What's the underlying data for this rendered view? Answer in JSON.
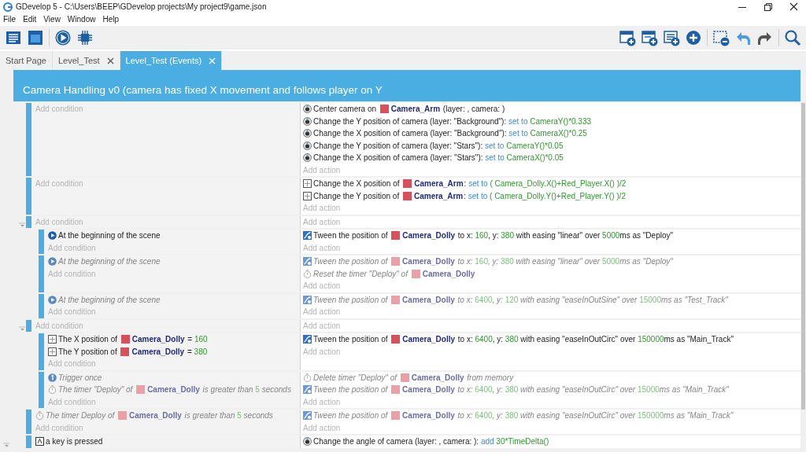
{
  "window": {
    "title": "GDevelop 5 - C:\\Users\\BEEP\\GDevelop projects\\My project9\\game.json"
  },
  "menu": [
    "File",
    "Edit",
    "View",
    "Window",
    "Help"
  ],
  "tabs": [
    {
      "label": "Start Page",
      "selected": false,
      "closable": false
    },
    {
      "label": "Level_Test",
      "selected": false,
      "closable": true
    },
    {
      "label": "Level_Test (Events)",
      "selected": true,
      "closable": true
    }
  ],
  "group": {
    "title": "Camera Handling v0 (camera has fixed X movement and follows player on Y",
    "expanded": true,
    "events": [
      {
        "add_condition": "Add condition",
        "add_action": "Add action",
        "actions": [
          {
            "kind": "camera",
            "disabled": false,
            "parts": [
              {
                "kind": "text",
                "text": "Center camera on "
              },
              {
                "kind": "object",
                "text": "Camera_Arm"
              },
              {
                "kind": "text",
                "text": " (layer: , camera: )"
              }
            ]
          },
          {
            "kind": "camera",
            "disabled": false,
            "parts": [
              {
                "kind": "text",
                "text": "Change the Y position of camera (layer: \"Background\"): "
              },
              {
                "kind": "operator",
                "text": "set to"
              },
              {
                "kind": "value",
                "text": " CameraY()*0.333"
              }
            ]
          },
          {
            "kind": "camera",
            "disabled": false,
            "parts": [
              {
                "kind": "text",
                "text": "Change the X position of camera (layer: \"Background\"): "
              },
              {
                "kind": "operator",
                "text": "set to"
              },
              {
                "kind": "value",
                "text": " CameraX()*0.25"
              }
            ]
          },
          {
            "kind": "camera",
            "disabled": false,
            "parts": [
              {
                "kind": "text",
                "text": "Change the Y position of camera (layer: \"Stars\"): "
              },
              {
                "kind": "operator",
                "text": "set to"
              },
              {
                "kind": "value",
                "text": " CameraY()*0.05"
              }
            ]
          },
          {
            "kind": "camera",
            "disabled": false,
            "parts": [
              {
                "kind": "text",
                "text": "Change the X position of camera (layer: \"Stars\"): "
              },
              {
                "kind": "operator",
                "text": "set to"
              },
              {
                "kind": "value",
                "text": " CameraX()*0.05"
              }
            ]
          }
        ]
      },
      {
        "add_condition": "Add condition",
        "add_action": "Add action",
        "actions": [
          {
            "kind": "position",
            "disabled": false,
            "parts": [
              {
                "kind": "text",
                "text": "Change the X position of "
              },
              {
                "kind": "object",
                "text": "Camera_Arm"
              },
              {
                "kind": "text",
                "text": ": "
              },
              {
                "kind": "operator",
                "text": "set to"
              },
              {
                "kind": "value",
                "text": " ( Camera_Dolly.X()+Red_Player.X() )/2"
              }
            ]
          },
          {
            "kind": "position",
            "disabled": false,
            "parts": [
              {
                "kind": "text",
                "text": "Change the Y position of "
              },
              {
                "kind": "object",
                "text": "Camera_Arm"
              },
              {
                "kind": "text",
                "text": ": "
              },
              {
                "kind": "operator",
                "text": "set to"
              },
              {
                "kind": "value",
                "text": " ( Camera_Dolly.Y()+Red_Player.Y() )/2"
              }
            ]
          }
        ]
      },
      {
        "add_condition": "Add condition",
        "add_action": "Add action",
        "expanded": true,
        "children": [
          {
            "add_condition": "Add condition",
            "add_action": "Add action",
            "conditions": [
              {
                "kind": "scene_start",
                "disabled": false,
                "parts": [
                  {
                    "kind": "text",
                    "text": "At the beginning of the scene"
                  }
                ]
              }
            ],
            "actions": [
              {
                "kind": "tween",
                "disabled": false,
                "parts": [
                  {
                    "kind": "text",
                    "text": "Tween the position of "
                  },
                  {
                    "kind": "object",
                    "text": "Camera_Dolly"
                  },
                  {
                    "kind": "text",
                    "text": " to x: "
                  },
                  {
                    "kind": "value",
                    "text": "160"
                  },
                  {
                    "kind": "text",
                    "text": ", y: "
                  },
                  {
                    "kind": "value",
                    "text": "380"
                  },
                  {
                    "kind": "text",
                    "text": " with easing \"linear\" over "
                  },
                  {
                    "kind": "value",
                    "text": "5000"
                  },
                  {
                    "kind": "text",
                    "text": "ms as \"Deploy\""
                  }
                ]
              }
            ]
          },
          {
            "add_condition": "Add condition",
            "add_action": "Add action",
            "conditions": [
              {
                "kind": "scene_start",
                "disabled": true,
                "parts": [
                  {
                    "kind": "text",
                    "text": "At the beginning of the scene"
                  }
                ]
              }
            ],
            "actions": [
              {
                "kind": "tween",
                "disabled": true,
                "parts": [
                  {
                    "kind": "text",
                    "text": "Tween the position of "
                  },
                  {
                    "kind": "object",
                    "text": "Camera_Dolly"
                  },
                  {
                    "kind": "text",
                    "text": " to x: "
                  },
                  {
                    "kind": "value",
                    "text": "160"
                  },
                  {
                    "kind": "text",
                    "text": ", y: "
                  },
                  {
                    "kind": "value",
                    "text": "380"
                  },
                  {
                    "kind": "text",
                    "text": " with easing \"linear\" over "
                  },
                  {
                    "kind": "value",
                    "text": "5000"
                  },
                  {
                    "kind": "text",
                    "text": "ms as \"Deploy\""
                  }
                ]
              },
              {
                "kind": "timer",
                "disabled": true,
                "parts": [
                  {
                    "kind": "text",
                    "text": "Reset the timer \"Deploy\" of "
                  },
                  {
                    "kind": "object",
                    "text": "Camera_Dolly"
                  }
                ]
              }
            ]
          },
          {
            "add_condition": "Add condition",
            "add_action": "Add action",
            "conditions": [
              {
                "kind": "scene_start",
                "disabled": true,
                "parts": [
                  {
                    "kind": "text",
                    "text": "At the beginning of the scene"
                  }
                ]
              }
            ],
            "actions": [
              {
                "kind": "tween",
                "disabled": true,
                "parts": [
                  {
                    "kind": "text",
                    "text": "Tween the position of "
                  },
                  {
                    "kind": "object",
                    "text": "Camera_Dolly"
                  },
                  {
                    "kind": "text",
                    "text": " to x: "
                  },
                  {
                    "kind": "value",
                    "text": "6400"
                  },
                  {
                    "kind": "text",
                    "text": ", y: "
                  },
                  {
                    "kind": "value",
                    "text": "120"
                  },
                  {
                    "kind": "text",
                    "text": " with easing \"easeInOutSine\" over "
                  },
                  {
                    "kind": "value",
                    "text": "15000"
                  },
                  {
                    "kind": "text",
                    "text": "ms as \"Test_Track\""
                  }
                ]
              }
            ]
          }
        ]
      },
      {
        "add_condition": "Add condition",
        "add_action": "Add action",
        "expanded": true,
        "children": [
          {
            "add_condition": "Add condition",
            "add_action": "Add action",
            "conditions": [
              {
                "kind": "position",
                "disabled": false,
                "parts": [
                  {
                    "kind": "text",
                    "text": "The X position of "
                  },
                  {
                    "kind": "object",
                    "text": "Camera_Dolly"
                  },
                  {
                    "kind": "text",
                    "text": " = "
                  },
                  {
                    "kind": "value",
                    "text": "160"
                  }
                ]
              },
              {
                "kind": "position",
                "disabled": false,
                "parts": [
                  {
                    "kind": "text",
                    "text": "The Y position of "
                  },
                  {
                    "kind": "object",
                    "text": "Camera_Dolly"
                  },
                  {
                    "kind": "text",
                    "text": " = "
                  },
                  {
                    "kind": "value",
                    "text": "380"
                  }
                ]
              }
            ],
            "actions": [
              {
                "kind": "tween",
                "disabled": false,
                "parts": [
                  {
                    "kind": "text",
                    "text": "Tween the position of "
                  },
                  {
                    "kind": "object",
                    "text": "Camera_Dolly"
                  },
                  {
                    "kind": "text",
                    "text": " to x: "
                  },
                  {
                    "kind": "value",
                    "text": "6400"
                  },
                  {
                    "kind": "text",
                    "text": ", y: "
                  },
                  {
                    "kind": "value",
                    "text": "380"
                  },
                  {
                    "kind": "text",
                    "text": " with easing \"easeInOutCirc\" over "
                  },
                  {
                    "kind": "value",
                    "text": "150000"
                  },
                  {
                    "kind": "text",
                    "text": "ms as \"Main_Track\""
                  }
                ]
              }
            ]
          },
          {
            "add_condition": "Add condition",
            "add_action": "Add action",
            "conditions": [
              {
                "kind": "trigger_once",
                "disabled": true,
                "parts": [
                  {
                    "kind": "text",
                    "text": "Trigger once"
                  }
                ]
              },
              {
                "kind": "timer",
                "disabled": true,
                "parts": [
                  {
                    "kind": "text",
                    "text": "The timer \"Deploy\" of "
                  },
                  {
                    "kind": "object",
                    "text": "Camera_Dolly"
                  },
                  {
                    "kind": "text",
                    "text": " is greater than "
                  },
                  {
                    "kind": "value",
                    "text": "5"
                  },
                  {
                    "kind": "text",
                    "text": " seconds"
                  }
                ]
              }
            ],
            "actions": [
              {
                "kind": "timer",
                "disabled": true,
                "parts": [
                  {
                    "kind": "text",
                    "text": "Delete timer \"Deploy\" of "
                  },
                  {
                    "kind": "object",
                    "text": "Camera_Dolly"
                  },
                  {
                    "kind": "text",
                    "text": " from memory"
                  }
                ]
              },
              {
                "kind": "tween",
                "disabled": true,
                "parts": [
                  {
                    "kind": "text",
                    "text": "Tween the position of "
                  },
                  {
                    "kind": "object",
                    "text": "Camera_Dolly"
                  },
                  {
                    "kind": "text",
                    "text": " to x: "
                  },
                  {
                    "kind": "value",
                    "text": "6400"
                  },
                  {
                    "kind": "text",
                    "text": ", y: "
                  },
                  {
                    "kind": "value",
                    "text": "380"
                  },
                  {
                    "kind": "text",
                    "text": " with easing \"easeInOutCirc\" over "
                  },
                  {
                    "kind": "value",
                    "text": "15000"
                  },
                  {
                    "kind": "text",
                    "text": "ms as \"Main_Track\""
                  }
                ]
              }
            ]
          }
        ]
      },
      {
        "add_condition": "Add condition",
        "add_action": "Add action",
        "conditions": [
          {
            "kind": "timer",
            "disabled": true,
            "parts": [
              {
                "kind": "text",
                "text": "The timer Deploy of "
              },
              {
                "kind": "object",
                "text": "Camera_Dolly"
              },
              {
                "kind": "text",
                "text": " is greater than "
              },
              {
                "kind": "value",
                "text": "5"
              },
              {
                "kind": "text",
                "text": " seconds"
              }
            ]
          }
        ],
        "actions": [
          {
            "kind": "tween",
            "disabled": true,
            "parts": [
              {
                "kind": "text",
                "text": "Tween the position of "
              },
              {
                "kind": "object",
                "text": "Camera_Dolly"
              },
              {
                "kind": "text",
                "text": " to x: "
              },
              {
                "kind": "value",
                "text": "6400"
              },
              {
                "kind": "text",
                "text": ", y: "
              },
              {
                "kind": "value",
                "text": "380"
              },
              {
                "kind": "text",
                "text": " with easing \"easeInOutCirc\" over "
              },
              {
                "kind": "value",
                "text": "150000"
              },
              {
                "kind": "text",
                "text": "ms as \"Main_Track\""
              }
            ]
          }
        ]
      },
      {
        "conditions": [
          {
            "kind": "keyboard",
            "disabled": false,
            "parts": [
              {
                "kind": "text",
                "text": "a key is pressed"
              }
            ]
          }
        ],
        "actions": [
          {
            "kind": "camera",
            "disabled": false,
            "parts": [
              {
                "kind": "text",
                "text": "Change the angle of camera (layer: , camera: ): "
              },
              {
                "kind": "operator",
                "text": "add"
              },
              {
                "kind": "value",
                "text": " 30*TimeDelta()"
              }
            ]
          }
        ]
      }
    ]
  }
}
